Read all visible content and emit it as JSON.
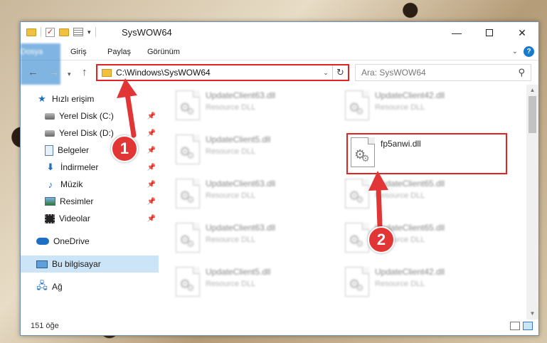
{
  "window": {
    "title": "SysWOW64",
    "minimize": "—",
    "close": "✕"
  },
  "ribbon": {
    "tabs": [
      "Dosya",
      "Giriş",
      "Paylaş",
      "Görünüm"
    ],
    "help": "?",
    "expand": "⌄"
  },
  "address": {
    "path": "C:\\Windows\\SysWOW64",
    "search_placeholder": "Ara: SysWOW64"
  },
  "sidebar": {
    "items": [
      {
        "label": "Hızlı erişim",
        "icon": "star-icon"
      },
      {
        "label": "Yerel Disk (C:)",
        "icon": "drive-icon",
        "pinned": true
      },
      {
        "label": "Yerel Disk (D:)",
        "icon": "drive-icon",
        "pinned": true
      },
      {
        "label": "Belgeler",
        "icon": "documents-icon",
        "pinned": true
      },
      {
        "label": "İndirmeler",
        "icon": "downloads-icon",
        "pinned": true
      },
      {
        "label": "Müzik",
        "icon": "music-icon",
        "pinned": true
      },
      {
        "label": "Resimler",
        "icon": "pictures-icon",
        "pinned": true
      },
      {
        "label": "Videolar",
        "icon": "videos-icon",
        "pinned": true
      },
      {
        "label": "OneDrive",
        "icon": "onedrive-icon"
      },
      {
        "label": "Bu bilgisayar",
        "icon": "this-pc-icon",
        "selected": true
      },
      {
        "label": "Ağ",
        "icon": "network-icon"
      }
    ]
  },
  "files": [
    {
      "name": "UpdateClient63.dll",
      "type": "Resource DLL"
    },
    {
      "name": "UpdateClient42.dll",
      "type": "Resource DLL"
    },
    {
      "name": "UpdateClient5.dll",
      "type": "Resource DLL"
    },
    {
      "name": "fp5anwi.dll",
      "type": "",
      "highlighted": true
    },
    {
      "name": "UpdateClient63.dll",
      "type": "Resource DLL"
    },
    {
      "name": "UpdateClient65.dll",
      "type": "Resource DLL"
    },
    {
      "name": "UpdateClient63.dll",
      "type": "Resource DLL"
    },
    {
      "name": "UpdateClient65.dll",
      "type": "Resource DLL"
    },
    {
      "name": "UpdateClient5.dll",
      "type": "Resource DLL"
    },
    {
      "name": "UpdateClient42.dll",
      "type": "Resource DLL"
    }
  ],
  "status": {
    "item_count": "151 öğe"
  },
  "annotations": {
    "step1": "1",
    "step2": "2",
    "color": "#e23636"
  }
}
